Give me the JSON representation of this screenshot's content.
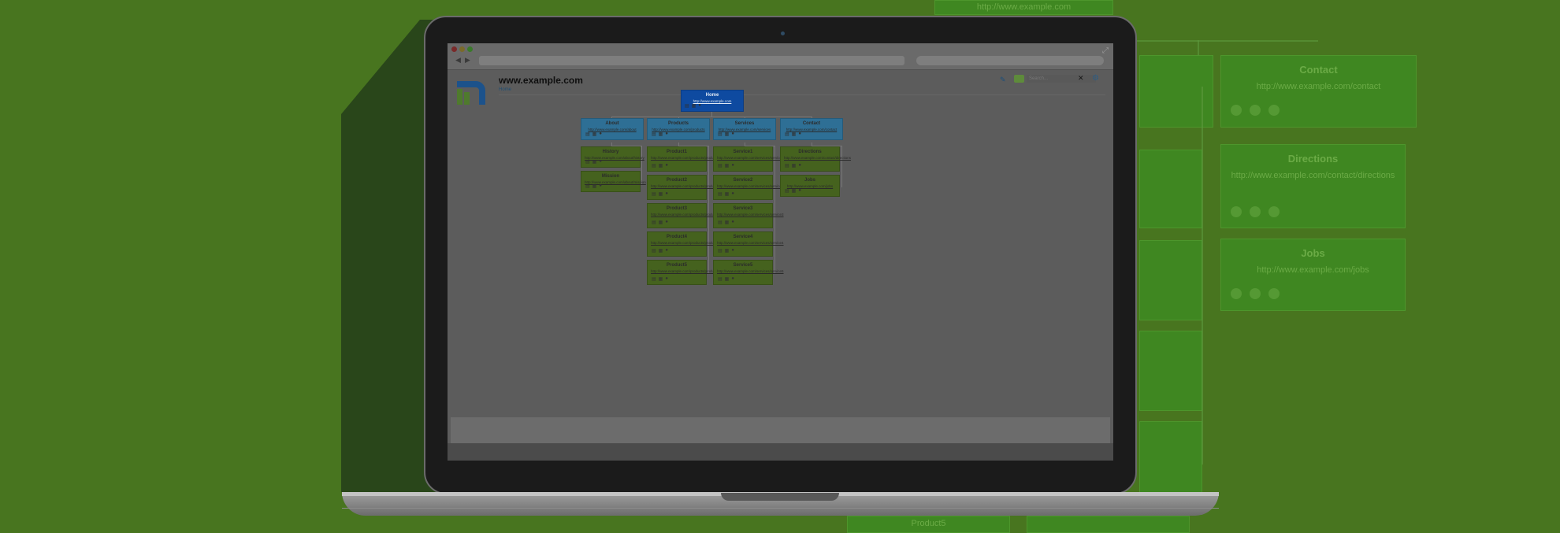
{
  "browser": {
    "url": "",
    "search_placeholder": ""
  },
  "site": {
    "title": "www.example.com",
    "breadcrumb": "Home",
    "search_placeholder": "Search...",
    "close_label": "✕"
  },
  "sitemap": {
    "home": {
      "title": "Home",
      "url": "http://www.example.com"
    },
    "about": {
      "title": "About",
      "url": "http://www.example.com/about"
    },
    "products": {
      "title": "Products",
      "url": "http://www.example.com/products"
    },
    "services": {
      "title": "Services",
      "url": "http://www.example.com/services"
    },
    "contact": {
      "title": "Contact",
      "url": "http://www.example.com/contact"
    },
    "history": {
      "title": "History",
      "url": "http://www.example.com/about/history"
    },
    "mission": {
      "title": "Mission",
      "url": "http://www.example.com/about/mission"
    },
    "product1": {
      "title": "Product1",
      "url": "http://www.example.com/products/product1"
    },
    "product2": {
      "title": "Product2",
      "url": "http://www.example.com/products/product2"
    },
    "product3": {
      "title": "Product3",
      "url": "http://www.example.com/products/product3"
    },
    "product4": {
      "title": "Product4",
      "url": "http://www.example.com/products/product4"
    },
    "product5": {
      "title": "Product5",
      "url": "http://www.example.com/products/product5"
    },
    "service1": {
      "title": "Service1",
      "url": "http://www.example.com/services/service1"
    },
    "service2": {
      "title": "Service2",
      "url": "http://www.example.com/services/service2"
    },
    "service3": {
      "title": "Service3",
      "url": "http://www.example.com/services/service3"
    },
    "service4": {
      "title": "Service4",
      "url": "http://www.example.com/services/service4"
    },
    "service5": {
      "title": "Service5",
      "url": "http://www.example.com/services/service5"
    },
    "directions": {
      "title": "Directions",
      "url": "http://www.example.com/contact/directions"
    },
    "jobs": {
      "title": "Jobs",
      "url": "http://www.example.com/jobs"
    }
  },
  "background_cards": {
    "contact": {
      "title": "Contact",
      "url": "http://www.example.com/contact"
    },
    "directions": {
      "title": "Directions",
      "url": "http://www.example.com/contact/directions"
    },
    "jobs": {
      "title": "Jobs",
      "url": "http://www.example.com/jobs"
    },
    "top_url": "http://www.example.com",
    "bottom_label": "Product5"
  },
  "icons": [
    "page-icon",
    "note-icon",
    "comment-icon",
    "edit-icon",
    "gear-icon",
    "close-icon"
  ],
  "colors": {
    "background": "#48751f",
    "home_node": "#0e4aa0",
    "level1_node": "#2e6f95",
    "level2_node": "#45621e"
  }
}
